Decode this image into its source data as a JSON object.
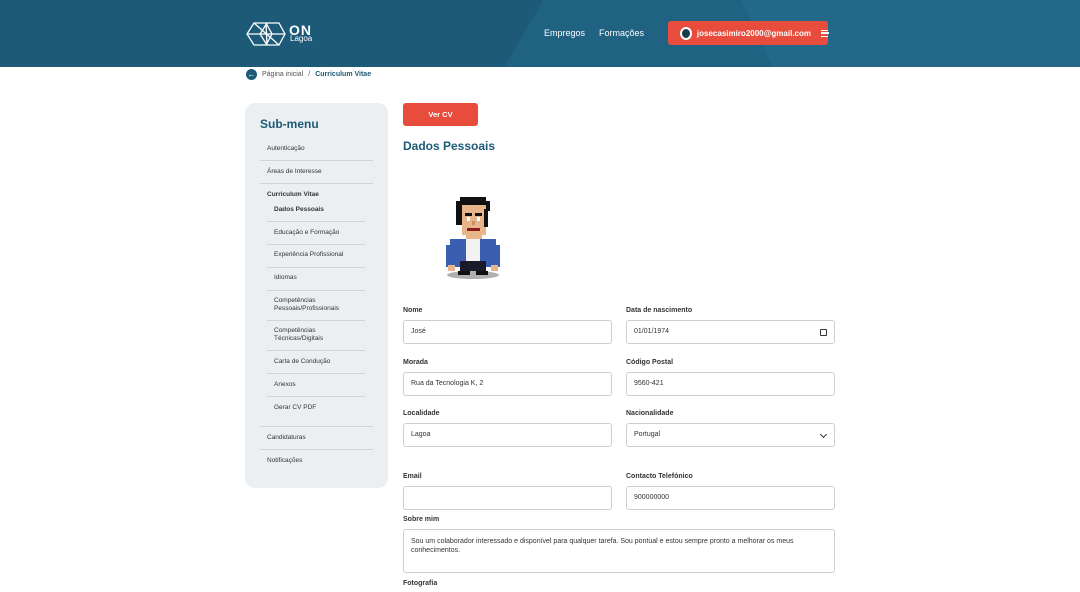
{
  "header": {
    "logo_main": "ON",
    "logo_sub": "Lagoa",
    "nav": [
      "Empregos",
      "Formações"
    ],
    "user_email": "josecasimiro2000@gmail.com"
  },
  "breadcrumb": {
    "home": "Página inicial",
    "separator": "/",
    "current": "Curriculum Vitae"
  },
  "sidebar": {
    "title": "Sub-menu",
    "items": [
      "Autenticação",
      "Áreas de Interesse",
      "Curriculum Vitae",
      "Candidaturas",
      "Notificações"
    ],
    "cv_subitems": [
      "Dados Pessoais",
      "Educação e Formação",
      "Experiência Profissional",
      "Idiomas",
      "Competências Pessoais/Profissionais",
      "Competências Técnicas/Digitais",
      "Carta de Condução",
      "Anexos",
      "Gerar CV PDF"
    ]
  },
  "main": {
    "view_cv_button": "Ver CV",
    "section_title": "Dados Pessoais",
    "fields": {
      "nome": {
        "label": "Nome",
        "value": "José"
      },
      "data_nascimento": {
        "label": "Data de nascimento",
        "value": "01/01/1974"
      },
      "morada": {
        "label": "Morada",
        "value": "Rua da Tecnologia K, 2"
      },
      "codigo_postal": {
        "label": "Código Postal",
        "value": "9560-421"
      },
      "localidade": {
        "label": "Localidade",
        "value": "Lagoa"
      },
      "nacionalidade": {
        "label": "Nacionalidade",
        "value": "Portugal"
      },
      "email": {
        "label": "Email",
        "value": ""
      },
      "contacto": {
        "label": "Contacto Telefónico",
        "value": "900000000"
      },
      "sobre_mim": {
        "label": "Sobre mim",
        "value": "Sou um colaborador interessado e disponível para qualquer tarefa. Sou pontual e estou sempre pronto a melhorar os meus conhecimentos."
      },
      "fotografia": {
        "label": "Fotografia"
      }
    }
  },
  "colors": {
    "header_bg": "#1c5a78",
    "accent": "#e74c3c",
    "sidebar_bg": "#eceff1"
  }
}
